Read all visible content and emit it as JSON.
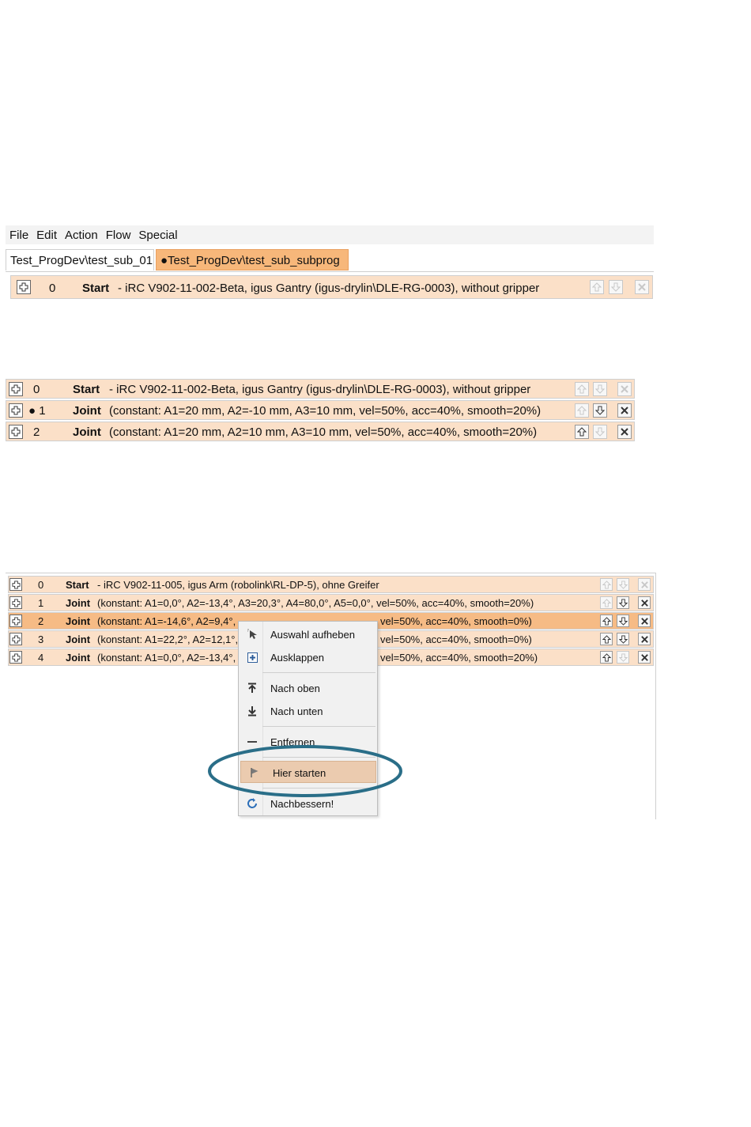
{
  "menubar": [
    "File",
    "Edit",
    "Action",
    "Flow",
    "Special"
  ],
  "tabs": [
    {
      "label": "Test_ProgDev\\test_sub_01"
    },
    {
      "label": "●Test_ProgDev\\test_sub_subprog"
    }
  ],
  "panel1": {
    "rows": [
      {
        "num": "0",
        "cmd": "Start",
        "desc": "- iRC V902-11-002-Beta, igus Gantry (igus-drylin\\DLE-RG-0003), without gripper"
      }
    ]
  },
  "panel2": {
    "rows": [
      {
        "num": "0",
        "cmd": "Start",
        "desc": "- iRC V902-11-002-Beta, igus Gantry (igus-drylin\\DLE-RG-0003), without gripper"
      },
      {
        "num": "● 1",
        "cmd": "Joint",
        "desc": "(constant: A1=20 mm, A2=-10 mm, A3=10 mm, vel=50%, acc=40%, smooth=20%)"
      },
      {
        "num": "2",
        "cmd": "Joint",
        "desc": "(constant: A1=20 mm, A2=10 mm, A3=10 mm, vel=50%, acc=40%, smooth=20%)"
      }
    ]
  },
  "panel3": {
    "rows": [
      {
        "num": "0",
        "cmd": "Start",
        "desc": "- iRC V902-11-005, igus Arm (robolink\\RL-DP-5), ohne Greifer",
        "tail": ""
      },
      {
        "num": "1",
        "cmd": "Joint",
        "desc": "(konstant: A1=0,0°, A2=-13,4°, A3=20,3°, A4=80,0°, A5=0,0°, vel=50%, acc=40%, smooth=20%)",
        "tail": ""
      },
      {
        "num": "2",
        "cmd": "Joint",
        "desc": "(konstant: A1=-14,6°, A2=9,4°,",
        "tail": "vel=50%, acc=40%, smooth=0%)"
      },
      {
        "num": "3",
        "cmd": "Joint",
        "desc": "(konstant: A1=22,2°, A2=12,1°,",
        "tail": "vel=50%, acc=40%, smooth=0%)"
      },
      {
        "num": "4",
        "cmd": "Joint",
        "desc": "(konstant: A1=0,0°, A2=-13,4°,",
        "tail": "vel=50%, acc=40%, smooth=20%)"
      }
    ],
    "context_menu": [
      {
        "label": "Auswahl aufheben",
        "icon": "cursor-deselect-icon"
      },
      {
        "label": "Ausklappen",
        "icon": "expand-icon"
      },
      {
        "label": "Nach oben",
        "icon": "arrow-up-icon"
      },
      {
        "label": "Nach unten",
        "icon": "arrow-down-icon"
      },
      {
        "label": "Entfernen",
        "icon": "minus-icon"
      },
      {
        "label": "Hier starten",
        "icon": "flag-icon"
      },
      {
        "label": "Nachbessern!",
        "icon": "refresh-icon"
      }
    ]
  },
  "colors": {
    "row_bg": "#fbe0c8",
    "selected_row_bg": "#f6bb85",
    "active_tab_bg": "#f7b77a",
    "highlight_ring": "#2a6e88"
  }
}
